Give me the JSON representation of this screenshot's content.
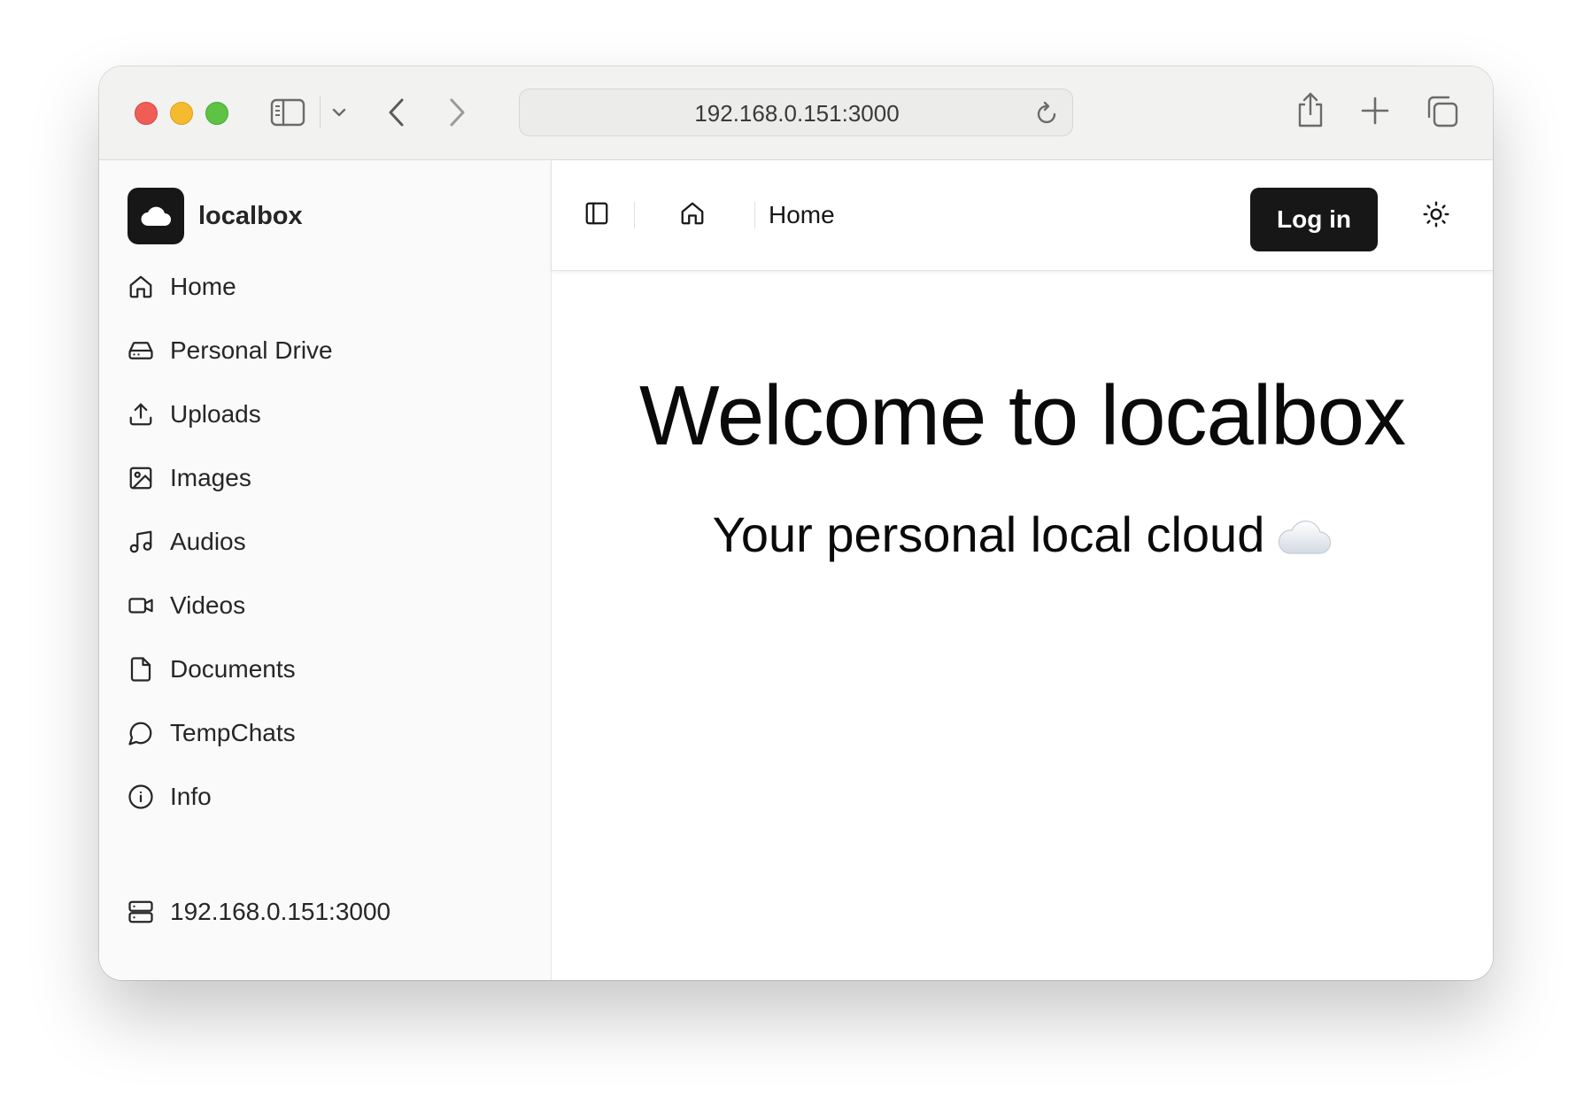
{
  "browser": {
    "url": "192.168.0.151:3000",
    "icons": [
      "sidebar-icon",
      "chevron-down-icon",
      "back-icon",
      "forward-icon",
      "reload-icon",
      "share-icon",
      "plus-icon",
      "tabs-icon"
    ]
  },
  "brand": {
    "name": "localbox",
    "logo_icon": "cloud-icon"
  },
  "sidebar": {
    "items": [
      {
        "label": "Home",
        "icon": "home-icon"
      },
      {
        "label": "Personal Drive",
        "icon": "drive-icon"
      },
      {
        "label": "Uploads",
        "icon": "upload-icon"
      },
      {
        "label": "Images",
        "icon": "image-icon"
      },
      {
        "label": "Audios",
        "icon": "music-icon"
      },
      {
        "label": "Videos",
        "icon": "video-icon"
      },
      {
        "label": "Documents",
        "icon": "document-icon"
      },
      {
        "label": "TempChats",
        "icon": "chat-icon"
      },
      {
        "label": "Info",
        "icon": "info-icon"
      }
    ],
    "server": {
      "label": "192.168.0.151:3000",
      "icon": "server-icon"
    }
  },
  "header": {
    "breadcrumb": "Home",
    "login_label": "Log in",
    "theme_icon": "sun-icon"
  },
  "main": {
    "title": "Welcome to localbox",
    "subtitle": "Your personal local cloud"
  }
}
